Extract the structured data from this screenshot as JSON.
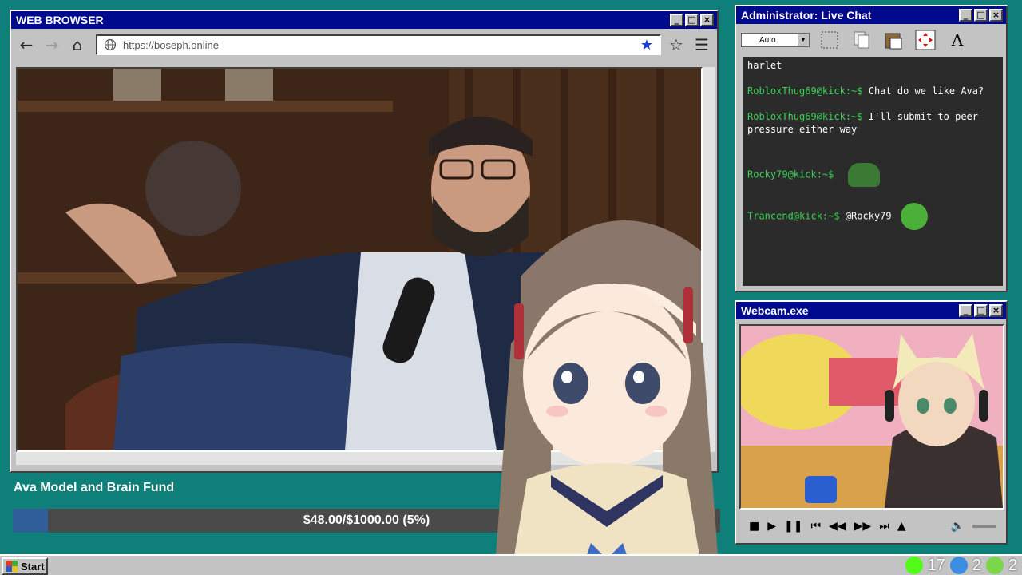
{
  "browser": {
    "title": "WEB BROWSER",
    "url": "https://boseph.online",
    "nav_back": "←",
    "nav_forward": "→",
    "nav_home": "⌂",
    "bookmark_star": "★",
    "add_star": "☆",
    "menu": "☰"
  },
  "window_buttons": {
    "minimize": "_",
    "maximize": "□",
    "close": "×"
  },
  "chat": {
    "title": "Administrator: Live Chat",
    "dropdown_value": "Auto",
    "text_tool": "A",
    "messages": [
      {
        "user": "",
        "text": "harlet"
      },
      {
        "user": "RobloxThug69@kick:~$",
        "text": "Chat do we like Ava?"
      },
      {
        "user": "RobloxThug69@kick:~$",
        "text": "I'll submit to peer pressure either way"
      },
      {
        "user": "Rocky79@kick:~$",
        "text": ""
      },
      {
        "user": "Trancend@kick:~$",
        "text": "@Rocky79"
      }
    ]
  },
  "webcam": {
    "title": "Webcam.exe",
    "controls": [
      "■",
      "▶",
      "❚❚",
      "⏮",
      "◀◀",
      "▶▶",
      "⏭",
      "▲",
      "🔈"
    ]
  },
  "fund": {
    "title": "Ava Model and Brain Fund",
    "progress_text": "$48.00/$1000.00 (5%)",
    "progress_fraction": 0.05
  },
  "taskbar": {
    "start_label": "Start",
    "tray": [
      {
        "icon": "kick-icon",
        "value": "17",
        "color": "#53fc18"
      },
      {
        "icon": "moon-icon",
        "value": "2",
        "color": "#3a8de0"
      },
      {
        "icon": "play-icon",
        "value": "2",
        "color": "#7bd64a"
      }
    ]
  }
}
